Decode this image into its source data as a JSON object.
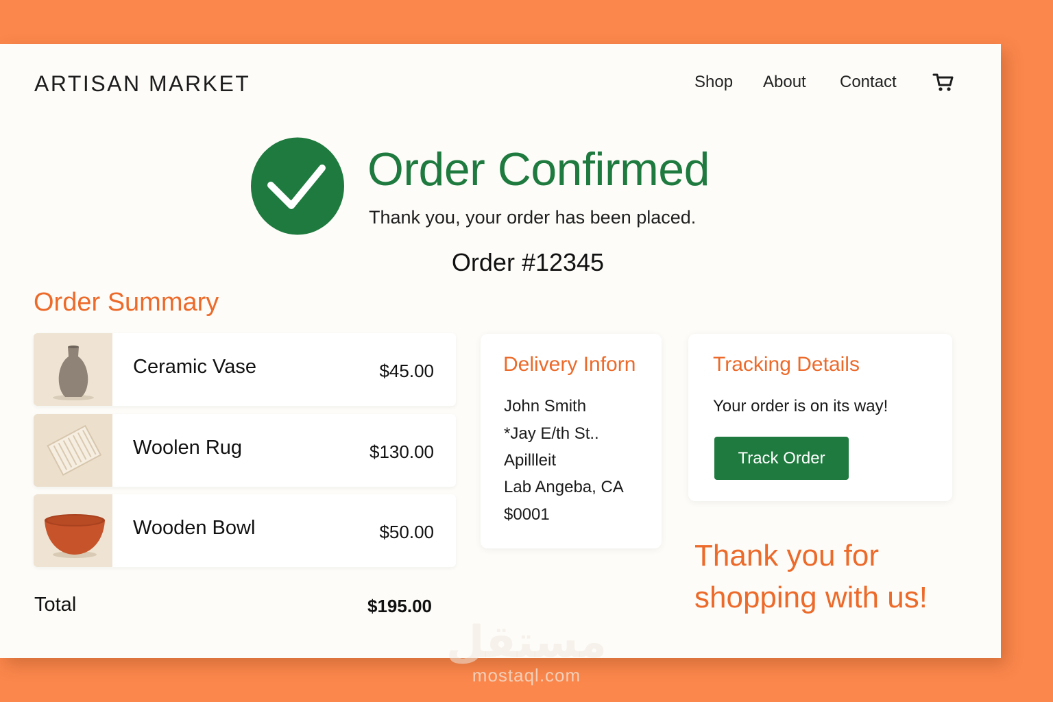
{
  "header": {
    "brand": "ARTISAN MARKET",
    "nav": [
      "Shop",
      "About",
      "Contact"
    ],
    "cart_icon": "cart-icon"
  },
  "confirmation": {
    "icon": "check-circle-icon",
    "title": "Order Confirmed",
    "subtitle": "Thank you, your order has been placed.",
    "order_number": "Order #12345"
  },
  "summary": {
    "title": "Order Summary",
    "items": [
      {
        "name": "Ceramic Vase",
        "price": "$45.00",
        "image": "ceramic-vase-image"
      },
      {
        "name": "Woolen Rug",
        "price": "$130.00",
        "image": "woolen-rug-image"
      },
      {
        "name": "Wooden Bowl",
        "price": "$50.00",
        "image": "wooden-bowl-image"
      }
    ],
    "total_label": "Total",
    "total_value": "$195.00"
  },
  "delivery": {
    "title": "Delivery Inforn",
    "lines": [
      "John Smith",
      "*Jay E/th St..",
      "Apillleit",
      "Lab Angeba, CA",
      "$0001"
    ]
  },
  "tracking": {
    "title": "Tracking Details",
    "status": "Your order is on its way!",
    "button_label": "Track Order"
  },
  "thanks": [
    "Thank you for",
    "shopping with us!"
  ],
  "watermark": {
    "arabic": "مستقل",
    "latin": "mostaql.com"
  },
  "colors": {
    "background": "#fb874c",
    "card": "#fdfcf8",
    "accent_green": "#1e7a3e",
    "accent_orange": "#ec6a2a"
  }
}
